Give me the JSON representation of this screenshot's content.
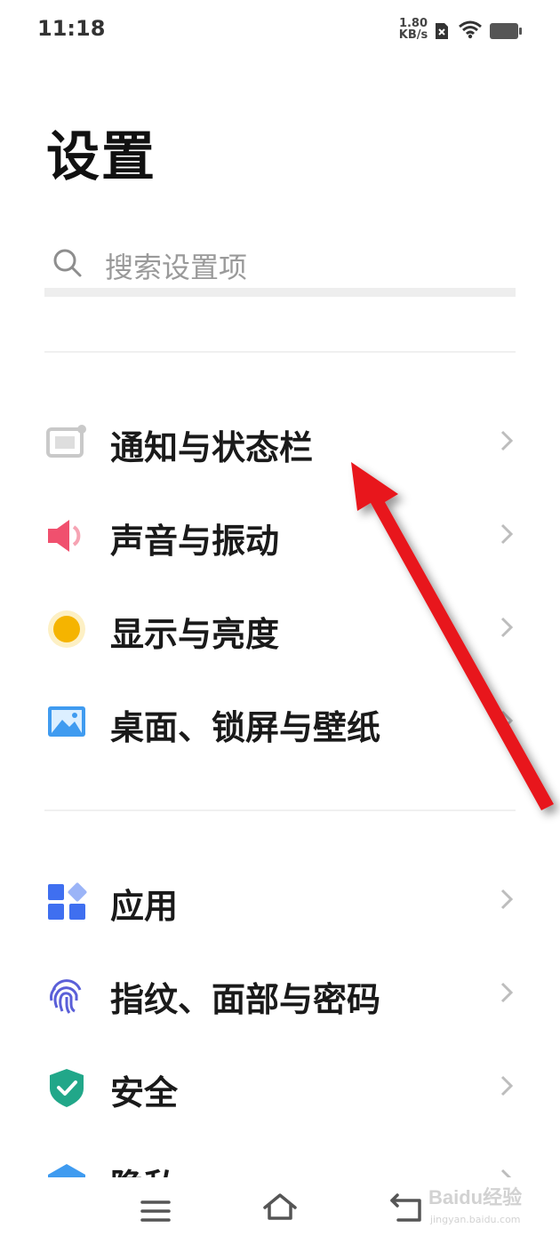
{
  "status_bar": {
    "time": "11:18",
    "net_speed_value": "1.80",
    "net_speed_unit": "KB/s",
    "icons": [
      "sim-off-icon",
      "wifi-icon",
      "battery-icon"
    ]
  },
  "title": "设置",
  "search": {
    "placeholder": "搜索设置项"
  },
  "groups": [
    {
      "items": [
        {
          "label": "通知与状态栏",
          "icon": "notification-icon",
          "icon_color": "#c9c9c9"
        },
        {
          "label": "声音与振动",
          "icon": "speaker-icon",
          "icon_color": "#f0506e"
        },
        {
          "label": "显示与亮度",
          "icon": "sun-icon",
          "icon_color": "#f5b400"
        },
        {
          "label": "桌面、锁屏与壁纸",
          "icon": "picture-icon",
          "icon_color": "#3f9bf0"
        }
      ]
    },
    {
      "items": [
        {
          "label": "应用",
          "icon": "apps-icon",
          "icon_color": "#3f6ff0"
        },
        {
          "label": "指纹、面部与密码",
          "icon": "fingerprint-icon",
          "icon_color": "#5a5fd8"
        },
        {
          "label": "安全",
          "icon": "shield-icon",
          "icon_color": "#21a789"
        },
        {
          "label": "隐私",
          "icon": "privacy-icon",
          "icon_color": "#3f9bf0"
        }
      ]
    }
  ],
  "nav_bar": {
    "icons": [
      "menu-icon",
      "home-icon",
      "back-icon"
    ]
  },
  "annotation": {
    "arrow_color": "#e8181c"
  },
  "watermark": {
    "brand": "Baidu经验",
    "site": "jingyan.baidu.com"
  }
}
